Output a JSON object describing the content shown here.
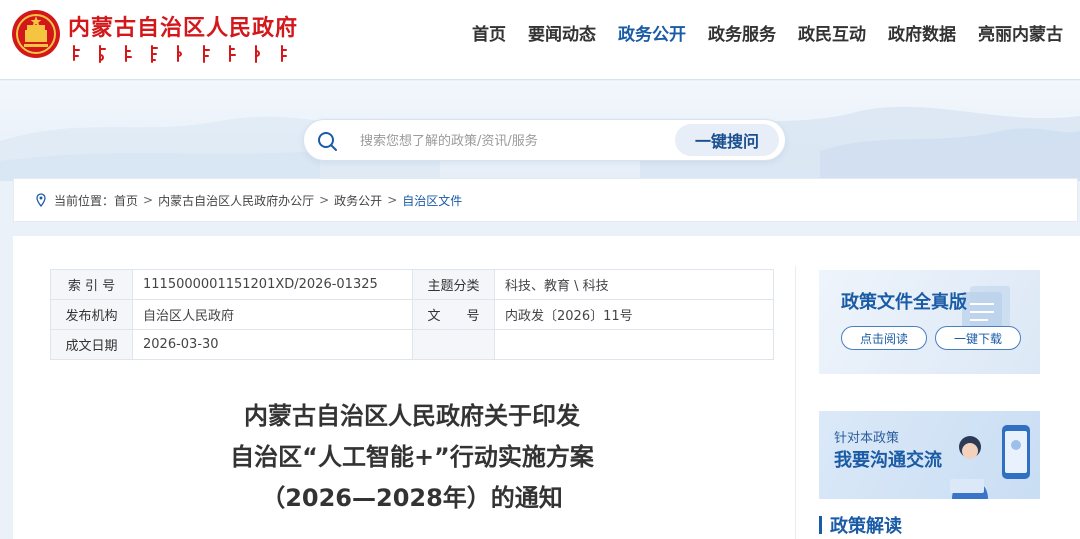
{
  "header": {
    "site_title": "内蒙古自治区人民政府",
    "nav": [
      {
        "label": "首页"
      },
      {
        "label": "要闻动态"
      },
      {
        "label": "政务公开",
        "active": true
      },
      {
        "label": "政务服务"
      },
      {
        "label": "政民互动"
      },
      {
        "label": "政府数据"
      },
      {
        "label": "亮丽内蒙古"
      }
    ]
  },
  "search": {
    "placeholder": "搜索您想了解的政策/资讯/服务",
    "button_label": "一键搜问"
  },
  "breadcrumb": {
    "prefix": "当前位置：",
    "items": [
      "首页",
      "内蒙古自治区人民政府办公厅",
      "政务公开",
      "自治区文件"
    ]
  },
  "meta": {
    "index_label": "索 引 号",
    "index_value": "1115000001151201XD/2026-01325",
    "topic_label": "主题分类",
    "topic_value": "科技、教育 \\ 科技",
    "issuer_label": "发布机构",
    "issuer_value": "自治区人民政府",
    "docno_label": "文　　号",
    "docno_value": "内政发〔2026〕11号",
    "date_label": "成文日期",
    "date_value": "2026-03-30"
  },
  "document": {
    "title_line1": "内蒙古自治区人民政府关于印发",
    "title_line2": "自治区“人工智能+”行动实施方案",
    "title_line3": "（2026—2028年）的通知"
  },
  "sidebar": {
    "full_title": "政策文件全真版",
    "read_button": "点击阅读",
    "download_button": "一键下载",
    "chat_sub": "针对本政策",
    "chat_title": "我要沟通交流",
    "section_title": "政策解读"
  },
  "colors": {
    "brand_red": "#d3171b",
    "accent_blue": "#1a5ba5"
  }
}
